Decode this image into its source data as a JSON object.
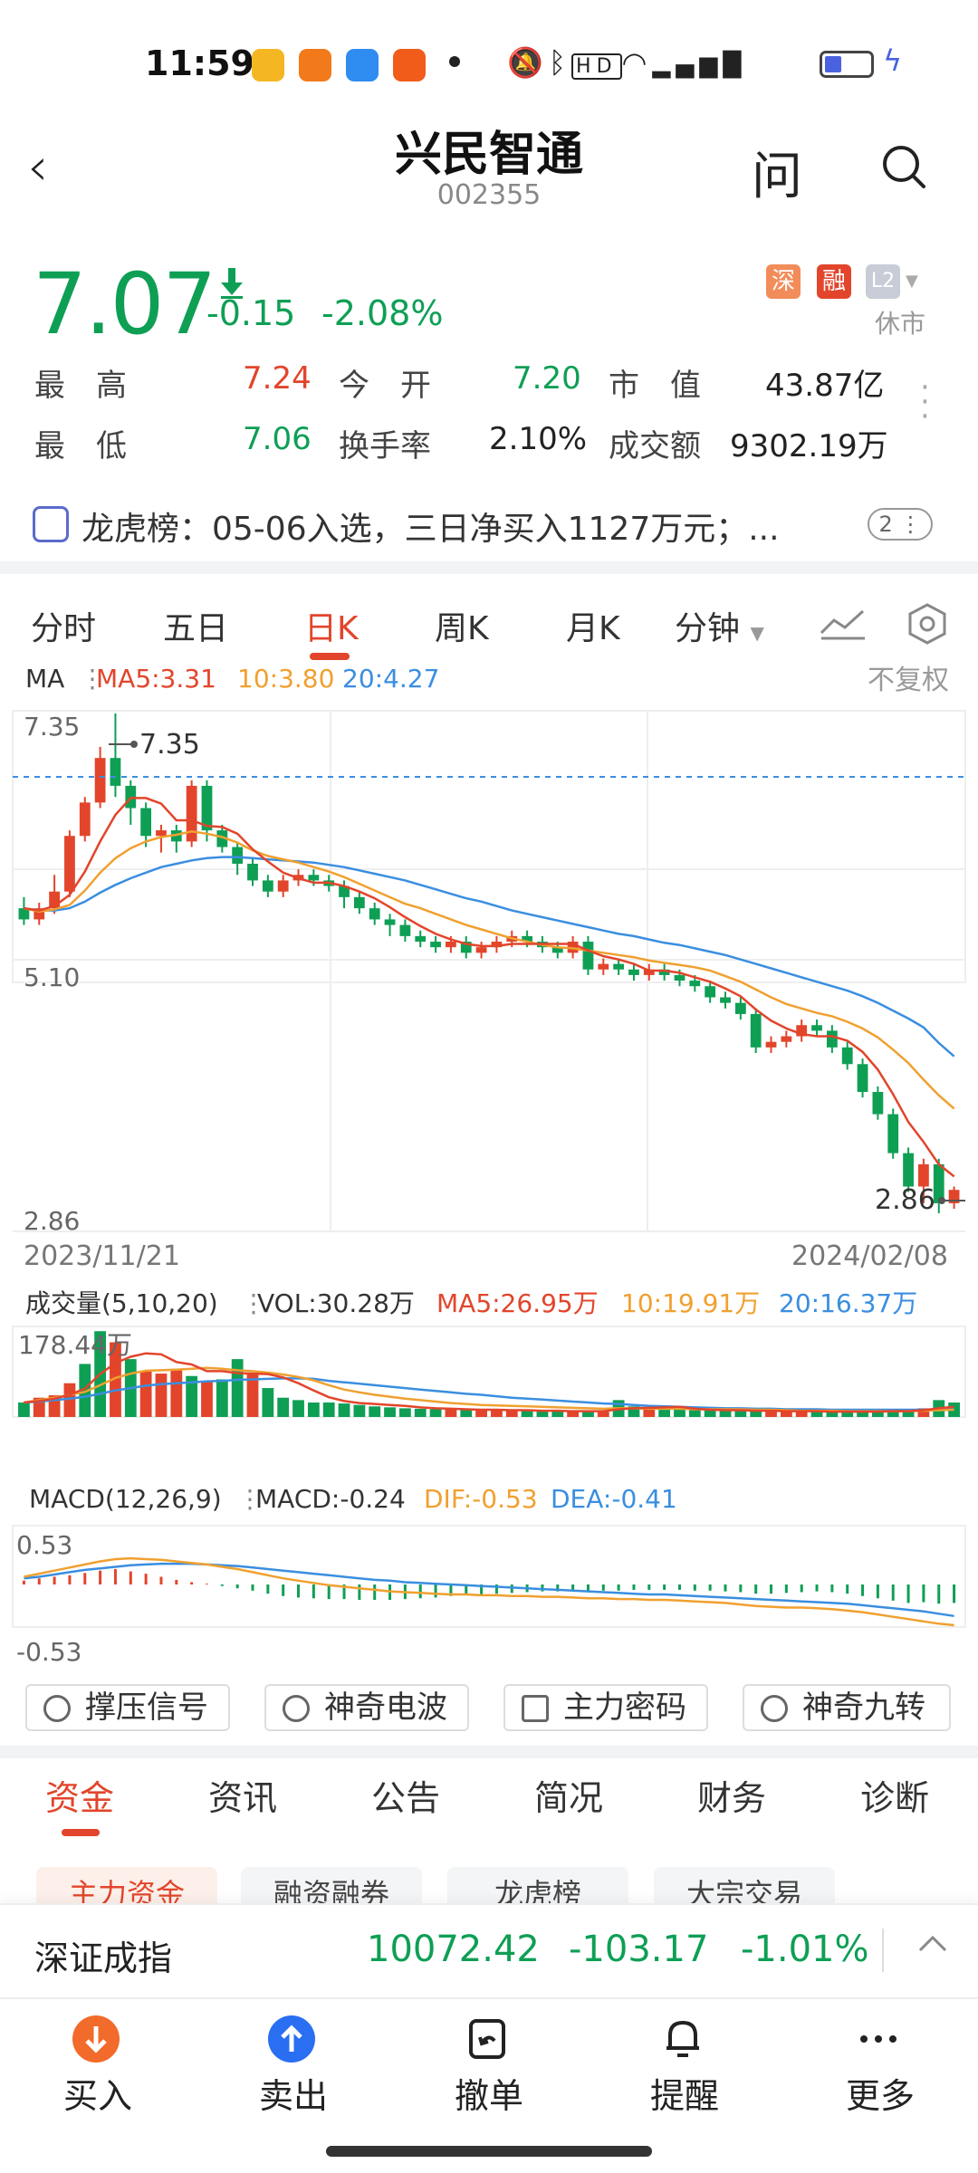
{
  "status_bar": {
    "time": "11:59"
  },
  "header": {
    "back_icon": "‹",
    "stock_name": "兴民智通",
    "stock_code": "002355",
    "ask_label": "问"
  },
  "quote": {
    "price": "7.07",
    "change": "-0.15",
    "change_pct": "-2.08%",
    "badges": {
      "sz": "深",
      "rong": "融",
      "l2": "L2"
    },
    "market_status": "休市",
    "high_label": "最　高",
    "high": "7.24",
    "open_label": "今　开",
    "open": "7.20",
    "mcap_label": "市　值",
    "mcap": "43.87亿",
    "low_label": "最　低",
    "low": "7.06",
    "turnover_label": "换手率",
    "turnover": "2.10%",
    "amount_label": "成交额",
    "amount": "9302.19万"
  },
  "dragon_tiger": {
    "text": "龙虎榜：05-06入选，三日净买入1127万元；...",
    "count": "2"
  },
  "k_tabs": [
    {
      "label": "分时"
    },
    {
      "label": "五日"
    },
    {
      "label": "日K"
    },
    {
      "label": "周K"
    },
    {
      "label": "月K"
    },
    {
      "label": "分钟"
    }
  ],
  "colors": {
    "up": "#e2452b",
    "down": "#0e9f55",
    "ma5": "#e2452b",
    "ma10": "#f0a030",
    "ma20": "#3a8ee0"
  },
  "chart_data": [
    {
      "type": "candlestick",
      "legend": {
        "ma": "MA",
        "ma5": "MA5:3.31",
        "ma10": "10:3.80",
        "ma20": "20:4.27",
        "adjust": "不复权"
      },
      "y_ticks": [
        "7.35",
        "5.10",
        "2.86"
      ],
      "high_label": "7.35",
      "low_label": "2.86",
      "x_start": "2023/11/21",
      "x_end": "2024/02/08",
      "ylim": [
        2.86,
        7.35
      ],
      "candles": [
        [
          5.6,
          5.5,
          5.7,
          5.45
        ],
        [
          5.5,
          5.6,
          5.65,
          5.45
        ],
        [
          5.6,
          5.75,
          5.9,
          5.55
        ],
        [
          5.75,
          6.25,
          6.3,
          5.7
        ],
        [
          6.25,
          6.55,
          6.6,
          6.2
        ],
        [
          6.55,
          6.95,
          7.05,
          6.5
        ],
        [
          6.95,
          6.7,
          7.35,
          6.6
        ],
        [
          6.7,
          6.5,
          6.75,
          6.35
        ],
        [
          6.5,
          6.25,
          6.55,
          6.15
        ],
        [
          6.25,
          6.3,
          6.35,
          6.1
        ],
        [
          6.3,
          6.2,
          6.35,
          6.1
        ],
        [
          6.2,
          6.7,
          6.75,
          6.15
        ],
        [
          6.7,
          6.3,
          6.75,
          6.2
        ],
        [
          6.3,
          6.15,
          6.35,
          6.1
        ],
        [
          6.15,
          6.0,
          6.2,
          5.9
        ],
        [
          6.0,
          5.85,
          6.05,
          5.8
        ],
        [
          5.85,
          5.75,
          5.9,
          5.7
        ],
        [
          5.75,
          5.85,
          5.9,
          5.7
        ],
        [
          5.85,
          5.9,
          5.95,
          5.8
        ],
        [
          5.9,
          5.85,
          5.95,
          5.8
        ],
        [
          5.85,
          5.8,
          5.9,
          5.75
        ],
        [
          5.8,
          5.7,
          5.85,
          5.6
        ],
        [
          5.7,
          5.6,
          5.75,
          5.55
        ],
        [
          5.6,
          5.5,
          5.65,
          5.45
        ],
        [
          5.5,
          5.45,
          5.55,
          5.35
        ],
        [
          5.45,
          5.35,
          5.5,
          5.3
        ],
        [
          5.35,
          5.3,
          5.4,
          5.25
        ],
        [
          5.3,
          5.25,
          5.35,
          5.2
        ],
        [
          5.25,
          5.3,
          5.35,
          5.2
        ],
        [
          5.3,
          5.2,
          5.35,
          5.15
        ],
        [
          5.2,
          5.25,
          5.3,
          5.15
        ],
        [
          5.25,
          5.3,
          5.35,
          5.2
        ],
        [
          5.3,
          5.35,
          5.4,
          5.25
        ],
        [
          5.35,
          5.3,
          5.4,
          5.25
        ],
        [
          5.3,
          5.25,
          5.35,
          5.2
        ],
        [
          5.25,
          5.2,
          5.3,
          5.15
        ],
        [
          5.2,
          5.3,
          5.35,
          5.15
        ],
        [
          5.3,
          5.05,
          5.35,
          5.0
        ],
        [
          5.05,
          5.1,
          5.15,
          5.0
        ],
        [
          5.1,
          5.05,
          5.15,
          5.0
        ],
        [
          5.05,
          5.0,
          5.1,
          4.95
        ],
        [
          5.0,
          5.05,
          5.1,
          4.95
        ],
        [
          5.05,
          5.0,
          5.1,
          4.95
        ],
        [
          5.0,
          4.95,
          5.05,
          4.9
        ],
        [
          4.95,
          4.9,
          5.0,
          4.85
        ],
        [
          4.9,
          4.8,
          4.95,
          4.75
        ],
        [
          4.8,
          4.75,
          4.85,
          4.7
        ],
        [
          4.75,
          4.65,
          4.8,
          4.6
        ],
        [
          4.65,
          4.35,
          4.7,
          4.3
        ],
        [
          4.35,
          4.4,
          4.45,
          4.3
        ],
        [
          4.4,
          4.45,
          4.5,
          4.35
        ],
        [
          4.45,
          4.55,
          4.6,
          4.4
        ],
        [
          4.55,
          4.5,
          4.6,
          4.45
        ],
        [
          4.5,
          4.35,
          4.55,
          4.3
        ],
        [
          4.35,
          4.2,
          4.4,
          4.15
        ],
        [
          4.2,
          3.95,
          4.25,
          3.9
        ],
        [
          3.95,
          3.75,
          4.0,
          3.7
        ],
        [
          3.75,
          3.4,
          3.8,
          3.35
        ],
        [
          3.4,
          3.1,
          3.45,
          3.05
        ],
        [
          3.1,
          3.3,
          3.35,
          2.95
        ],
        [
          3.3,
          2.95,
          3.35,
          2.86
        ],
        [
          2.95,
          3.07,
          3.1,
          2.9
        ]
      ],
      "ma5": [
        5.6,
        5.58,
        5.62,
        5.72,
        5.93,
        6.2,
        6.44,
        6.59,
        6.59,
        6.54,
        6.39,
        6.39,
        6.34,
        6.33,
        6.27,
        6.13,
        6.02,
        5.92,
        5.87,
        5.83,
        5.83,
        5.8,
        5.75,
        5.69,
        5.61,
        5.52,
        5.44,
        5.37,
        5.32,
        5.28,
        5.26,
        5.26,
        5.28,
        5.28,
        5.28,
        5.28,
        5.28,
        5.22,
        5.17,
        5.14,
        5.1,
        5.04,
        5.04,
        5.02,
        4.98,
        4.94,
        4.88,
        4.81,
        4.69,
        4.59,
        4.52,
        4.47,
        4.45,
        4.45,
        4.41,
        4.31,
        4.15,
        3.93,
        3.68,
        3.5,
        3.3,
        3.19
      ],
      "ma10": [
        5.6,
        5.57,
        5.59,
        5.63,
        5.76,
        5.92,
        6.05,
        6.14,
        6.2,
        6.24,
        6.26,
        6.29,
        6.27,
        6.24,
        6.19,
        6.12,
        6.07,
        6.04,
        6.01,
        5.97,
        5.93,
        5.88,
        5.82,
        5.76,
        5.7,
        5.64,
        5.6,
        5.55,
        5.5,
        5.45,
        5.41,
        5.37,
        5.33,
        5.3,
        5.27,
        5.25,
        5.24,
        5.22,
        5.2,
        5.18,
        5.16,
        5.13,
        5.11,
        5.09,
        5.07,
        5.04,
        4.99,
        4.94,
        4.87,
        4.8,
        4.74,
        4.7,
        4.66,
        4.63,
        4.58,
        4.52,
        4.44,
        4.33,
        4.21,
        4.06,
        3.92,
        3.8
      ],
      "ma20": [
        5.6,
        5.58,
        5.58,
        5.6,
        5.66,
        5.74,
        5.81,
        5.87,
        5.92,
        5.97,
        6.0,
        6.03,
        6.05,
        6.06,
        6.06,
        6.05,
        6.04,
        6.03,
        6.02,
        6.01,
        5.99,
        5.97,
        5.94,
        5.91,
        5.88,
        5.85,
        5.81,
        5.77,
        5.73,
        5.69,
        5.66,
        5.62,
        5.58,
        5.55,
        5.52,
        5.49,
        5.46,
        5.43,
        5.4,
        5.37,
        5.35,
        5.32,
        5.29,
        5.27,
        5.24,
        5.21,
        5.18,
        5.14,
        5.1,
        5.06,
        5.02,
        4.98,
        4.94,
        4.9,
        4.86,
        4.81,
        4.75,
        4.68,
        4.61,
        4.53,
        4.39,
        4.27
      ]
    },
    {
      "type": "bar",
      "legend": {
        "title": "成交量(5,10,20)",
        "vol": "VOL:30.28万",
        "ma5": "MA5:26.95万",
        "ma10": "10:19.91万",
        "ma20": "20:16.37万"
      },
      "y_max_label": "178.44万",
      "ylim": [
        0,
        178.44
      ],
      "values": [
        30,
        40,
        45,
        70,
        110,
        178,
        155,
        120,
        95,
        90,
        100,
        85,
        75,
        78,
        120,
        90,
        60,
        40,
        35,
        30,
        30,
        28,
        25,
        22,
        20,
        18,
        17,
        16,
        15,
        15,
        14,
        14,
        13,
        13,
        12,
        12,
        11,
        11,
        11,
        35,
        22,
        18,
        16,
        15,
        14,
        14,
        13,
        13,
        12,
        12,
        12,
        11,
        11,
        11,
        11,
        12,
        12,
        13,
        14,
        18,
        35,
        30
      ],
      "directions": [
        "d",
        "u",
        "u",
        "u",
        "d",
        "d",
        "u",
        "d",
        "u",
        "u",
        "u",
        "d",
        "u",
        "d",
        "d",
        "u",
        "d",
        "d",
        "d",
        "d",
        "d",
        "d",
        "d",
        "d",
        "d",
        "d",
        "d",
        "d",
        "u",
        "d",
        "u",
        "u",
        "u",
        "d",
        "d",
        "d",
        "u",
        "d",
        "u",
        "d",
        "d",
        "u",
        "d",
        "d",
        "d",
        "d",
        "d",
        "d",
        "d",
        "u",
        "u",
        "u",
        "d",
        "d",
        "d",
        "d",
        "d",
        "d",
        "d",
        "u",
        "d",
        "d"
      ],
      "ma5": [
        30,
        33,
        38,
        46,
        59,
        89,
        112,
        125,
        132,
        130,
        114,
        109,
        95,
        95,
        91,
        90,
        89,
        82,
        70,
        55,
        41,
        33,
        29,
        27,
        25,
        23,
        20,
        18,
        17,
        16,
        15,
        15,
        14,
        14,
        13,
        13,
        12,
        12,
        12,
        16,
        18,
        19,
        20,
        21,
        17,
        15,
        14,
        14,
        13,
        13,
        12,
        12,
        12,
        11,
        11,
        11,
        11,
        12,
        12,
        14,
        18,
        21
      ],
      "ma10": [
        30,
        35,
        40,
        46,
        52,
        66,
        81,
        90,
        96,
        97,
        98,
        100,
        102,
        100,
        97,
        95,
        92,
        88,
        83,
        76,
        66,
        57,
        51,
        46,
        42,
        38,
        35,
        32,
        29,
        27,
        25,
        24,
        23,
        22,
        21,
        20,
        19,
        18,
        17,
        18,
        18,
        17,
        17,
        17,
        16,
        16,
        16,
        16,
        15,
        15,
        14,
        13,
        13,
        13,
        12,
        12,
        12,
        12,
        12,
        13,
        14,
        15
      ],
      "ma20": [
        30,
        32,
        35,
        38,
        42,
        48,
        55,
        60,
        65,
        68,
        70,
        72,
        74,
        75,
        77,
        78,
        79,
        80,
        80,
        79,
        75,
        72,
        69,
        66,
        63,
        60,
        57,
        54,
        51,
        48,
        46,
        43,
        40,
        38,
        36,
        34,
        32,
        30,
        28,
        27,
        25,
        23,
        22,
        21,
        20,
        19,
        18,
        18,
        17,
        17,
        16,
        16,
        16,
        15,
        15,
        15,
        15,
        15,
        15,
        15,
        16,
        16
      ]
    },
    {
      "type": "bar",
      "legend": {
        "title": "MACD(12,26,9)",
        "macd": "MACD:-0.24",
        "dif": "DIF:-0.53",
        "dea": "DEA:-0.41"
      },
      "y_ticks": [
        "0.53",
        "-0.53"
      ],
      "ylim": [
        -0.53,
        0.53
      ],
      "macd": [
        0.05,
        0.08,
        0.1,
        0.12,
        0.15,
        0.18,
        0.2,
        0.17,
        0.14,
        0.1,
        0.06,
        0.03,
        0.01,
        -0.02,
        -0.05,
        -0.08,
        -0.12,
        -0.15,
        -0.17,
        -0.18,
        -0.19,
        -0.19,
        -0.2,
        -0.2,
        -0.2,
        -0.19,
        -0.18,
        -0.17,
        -0.15,
        -0.14,
        -0.13,
        -0.12,
        -0.11,
        -0.1,
        -0.09,
        -0.09,
        -0.08,
        -0.09,
        -0.08,
        -0.08,
        -0.07,
        -0.07,
        -0.07,
        -0.07,
        -0.08,
        -0.08,
        -0.09,
        -0.1,
        -0.12,
        -0.12,
        -0.11,
        -0.1,
        -0.09,
        -0.1,
        -0.12,
        -0.15,
        -0.18,
        -0.21,
        -0.24,
        -0.23,
        -0.25,
        -0.24
      ],
      "dif": [
        0.1,
        0.14,
        0.18,
        0.22,
        0.26,
        0.3,
        0.33,
        0.34,
        0.33,
        0.32,
        0.3,
        0.28,
        0.26,
        0.23,
        0.2,
        0.16,
        0.12,
        0.08,
        0.05,
        0.02,
        -0.01,
        -0.03,
        -0.05,
        -0.07,
        -0.09,
        -0.1,
        -0.11,
        -0.12,
        -0.13,
        -0.13,
        -0.14,
        -0.14,
        -0.15,
        -0.15,
        -0.16,
        -0.16,
        -0.17,
        -0.18,
        -0.18,
        -0.19,
        -0.19,
        -0.2,
        -0.2,
        -0.21,
        -0.22,
        -0.23,
        -0.24,
        -0.26,
        -0.28,
        -0.29,
        -0.3,
        -0.3,
        -0.31,
        -0.32,
        -0.34,
        -0.36,
        -0.39,
        -0.42,
        -0.45,
        -0.48,
        -0.51,
        -0.53
      ],
      "dea": [
        0.08,
        0.1,
        0.13,
        0.16,
        0.19,
        0.21,
        0.23,
        0.25,
        0.26,
        0.27,
        0.27,
        0.27,
        0.26,
        0.25,
        0.24,
        0.22,
        0.2,
        0.18,
        0.16,
        0.14,
        0.12,
        0.1,
        0.08,
        0.06,
        0.05,
        0.03,
        0.02,
        0.01,
        0.0,
        -0.01,
        -0.02,
        -0.03,
        -0.04,
        -0.05,
        -0.06,
        -0.07,
        -0.08,
        -0.09,
        -0.1,
        -0.11,
        -0.12,
        -0.13,
        -0.13,
        -0.14,
        -0.15,
        -0.16,
        -0.17,
        -0.18,
        -0.19,
        -0.2,
        -0.21,
        -0.22,
        -0.23,
        -0.24,
        -0.25,
        -0.27,
        -0.29,
        -0.31,
        -0.33,
        -0.35,
        -0.38,
        -0.41
      ]
    }
  ],
  "tools": [
    {
      "label": "撑压信号"
    },
    {
      "label": "神奇电波"
    },
    {
      "label": "主力密码"
    },
    {
      "label": "神奇九转"
    }
  ],
  "bottom_tabs": [
    {
      "label": "资金"
    },
    {
      "label": "资讯"
    },
    {
      "label": "公告"
    },
    {
      "label": "简况"
    },
    {
      "label": "财务"
    },
    {
      "label": "诊断"
    }
  ],
  "chips": [
    {
      "label": "主力资金"
    },
    {
      "label": "融资融券"
    },
    {
      "label": "龙虎榜"
    },
    {
      "label": "大宗交易"
    }
  ],
  "index_bar": {
    "name": "深证成指",
    "value": "10072.42",
    "change": "-103.17",
    "pct": "-1.01%"
  },
  "bottom_nav": [
    {
      "label": "买入"
    },
    {
      "label": "卖出"
    },
    {
      "label": "撤单"
    },
    {
      "label": "提醒"
    },
    {
      "label": "更多"
    }
  ]
}
